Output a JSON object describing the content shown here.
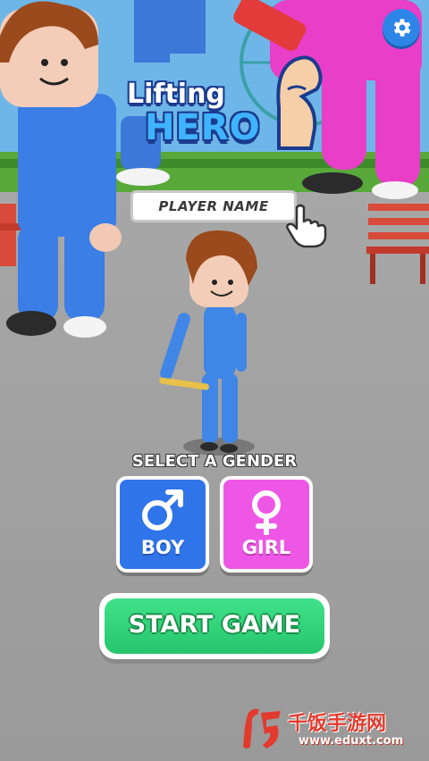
{
  "game": {
    "logo_top": "Lifting",
    "logo_bottom": "HERO"
  },
  "player_name": {
    "placeholder": "PLAYER NAME"
  },
  "gender": {
    "heading": "SELECT A GENDER",
    "options": [
      {
        "label": "BOY",
        "icon": "male-icon",
        "color": "#2f74e9"
      },
      {
        "label": "GIRL",
        "icon": "female-icon",
        "color": "#ee57e6"
      }
    ]
  },
  "start": {
    "label": "START GAME",
    "color": "#27c56c"
  },
  "settings": {
    "icon": "gear-icon"
  },
  "watermark": {
    "title": "千饭手游网",
    "url": "www.eduxt.com"
  }
}
